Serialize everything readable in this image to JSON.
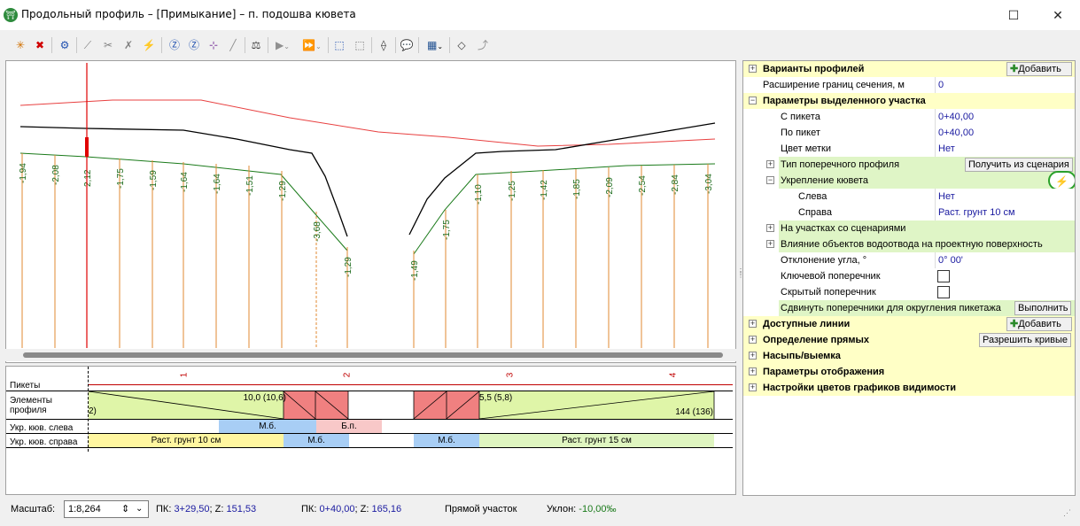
{
  "window": {
    "title": "Продольный профиль – [Примыкание] – п. подошва кювета",
    "app_icon_glyph": "⛩",
    "maximize_glyph": "☐",
    "close_glyph": "✕"
  },
  "toolbar": {
    "buttons": [
      {
        "name": "add-point-icon",
        "glyph": "✳",
        "color": "#d07000"
      },
      {
        "name": "delete-point-icon",
        "glyph": "✖",
        "color": "#d00000"
      },
      {
        "name": "profile-settings-icon",
        "glyph": "⚙",
        "color": "#2050b0"
      },
      {
        "name": "line-tool-icon",
        "glyph": "⟋",
        "color": "#808080"
      },
      {
        "name": "cut-line-icon",
        "glyph": "✂",
        "color": "#808080"
      },
      {
        "name": "delete-line-icon",
        "glyph": "✗",
        "color": "#808080"
      },
      {
        "name": "lightning-icon",
        "glyph": "⚡",
        "color": "#606060"
      },
      {
        "name": "vertex-z-icon",
        "glyph": "Ⓩ",
        "color": "#2050b0"
      },
      {
        "name": "vertex-z2-icon",
        "glyph": "Ⓩ",
        "color": "#2050b0"
      },
      {
        "name": "node-edit-icon",
        "glyph": "⊹",
        "color": "#8040a0"
      },
      {
        "name": "pen-icon",
        "glyph": "╱",
        "color": "#909090"
      },
      {
        "name": "balance-icon",
        "glyph": "⚖",
        "color": "#404040"
      },
      {
        "name": "play-icon",
        "glyph": "▶",
        "color": "#909090"
      },
      {
        "name": "play-multi-icon",
        "glyph": "⏩",
        "color": "#909090"
      },
      {
        "name": "select-frame-icon",
        "glyph": "⬚",
        "color": "#2050b0"
      },
      {
        "name": "select-frame2-icon",
        "glyph": "⬚",
        "color": "#707070"
      },
      {
        "name": "measure-icon",
        "glyph": "⟠",
        "color": "#404040"
      },
      {
        "name": "comment-icon",
        "glyph": "💬",
        "color": "#c09000"
      },
      {
        "name": "export-icon",
        "glyph": "▦",
        "color": "#205090"
      },
      {
        "name": "diamond-icon",
        "glyph": "◇",
        "color": "#404040"
      },
      {
        "name": "curve-icon",
        "glyph": "⤴",
        "color": "#909090"
      }
    ]
  },
  "profile_chart": {
    "depth_labels": [
      "-1,94",
      "-2,08",
      "2,12",
      "-1,75",
      "-1,59",
      "-1,64",
      "-1,64",
      "-1,51",
      "-1,29",
      "-3,68",
      "-1,29",
      "-1,49",
      "-1,75",
      "-1,10",
      "-1,25",
      "-1,42",
      "-1,85",
      "-2,09",
      "-2,54",
      "-2,84",
      "-3,04"
    ],
    "colors": {
      "red_line": "#e84040",
      "black_line": "#000000",
      "green_line": "#1a7a1a",
      "stake": "#e08a30",
      "cursor": "#e00000"
    }
  },
  "profile_table": {
    "rows": {
      "pickets": "Пикеты",
      "elements_line1": "Элементы",
      "elements_line2": "профиля",
      "left_ditch": "Укр. кюв. слева",
      "right_ditch": "Укр. кюв. справа"
    },
    "picket_ticks": [
      "1",
      "2",
      "3",
      "4"
    ],
    "element_texts": {
      "left_edge": "2)",
      "seg1": "10,0 (10,6)",
      "seg2": "5,5 (5,8)",
      "seg3": "144 (136)"
    },
    "left_ditch_segments": [
      "М.б.",
      "Б.п."
    ],
    "right_ditch_segments": [
      "Раст. грунт 10 см",
      "М.б.",
      "М.б.",
      "Раст. грунт 15 см"
    ]
  },
  "properties": {
    "rows": [
      {
        "label": "Варианты профилей",
        "button": "Добавить",
        "bold": true
      },
      {
        "label": "Расширение границ сечения, м",
        "value": "0"
      },
      {
        "label": "Параметры выделенного участка",
        "bold": true
      },
      {
        "label": "С пикета",
        "value": "0+40,00"
      },
      {
        "label": "По пикет",
        "value": "0+40,00"
      },
      {
        "label": "Цвет метки",
        "value": "Нет"
      },
      {
        "label": "Тип поперечного профиля",
        "button": "Получить из сценария"
      },
      {
        "label": "Укрепление кювета"
      },
      {
        "label": "Слева",
        "value": "Нет"
      },
      {
        "label": "Справа",
        "value": "Раст. грунт 10 см"
      },
      {
        "label": "На участках со сценариями"
      },
      {
        "label": "Влияние объектов водоотвода на проектную поверхность"
      },
      {
        "label": "Отклонение угла, °",
        "value": "0° 00'"
      },
      {
        "label": "Ключевой поперечник"
      },
      {
        "label": "Скрытый поперечник"
      },
      {
        "label": "Сдвинуть поперечники для округления пикетажа",
        "button": "Выполнить"
      },
      {
        "label": "Доступные линии",
        "button": "Добавить",
        "bold": true
      },
      {
        "label": "Определение прямых",
        "button": "Разрешить кривые",
        "bold": true
      },
      {
        "label": "Насыпь/выемка",
        "bold": true
      },
      {
        "label": "Параметры отображения",
        "bold": true
      },
      {
        "label": "Настройки цветов графиков видимости",
        "bold": true
      }
    ],
    "lightning_glyph": "⚡"
  },
  "status": {
    "scale_label": "Масштаб:",
    "scale_value": "1:8,264",
    "pk_label": "ПК:",
    "pk1": "3+29,50",
    "z_label": "Z:",
    "z1": "151,53",
    "pk2": "0+40,00",
    "z2": "165,16",
    "segment": "Прямой участок",
    "slope_label": "Уклон:",
    "slope": "-10,00‰"
  }
}
